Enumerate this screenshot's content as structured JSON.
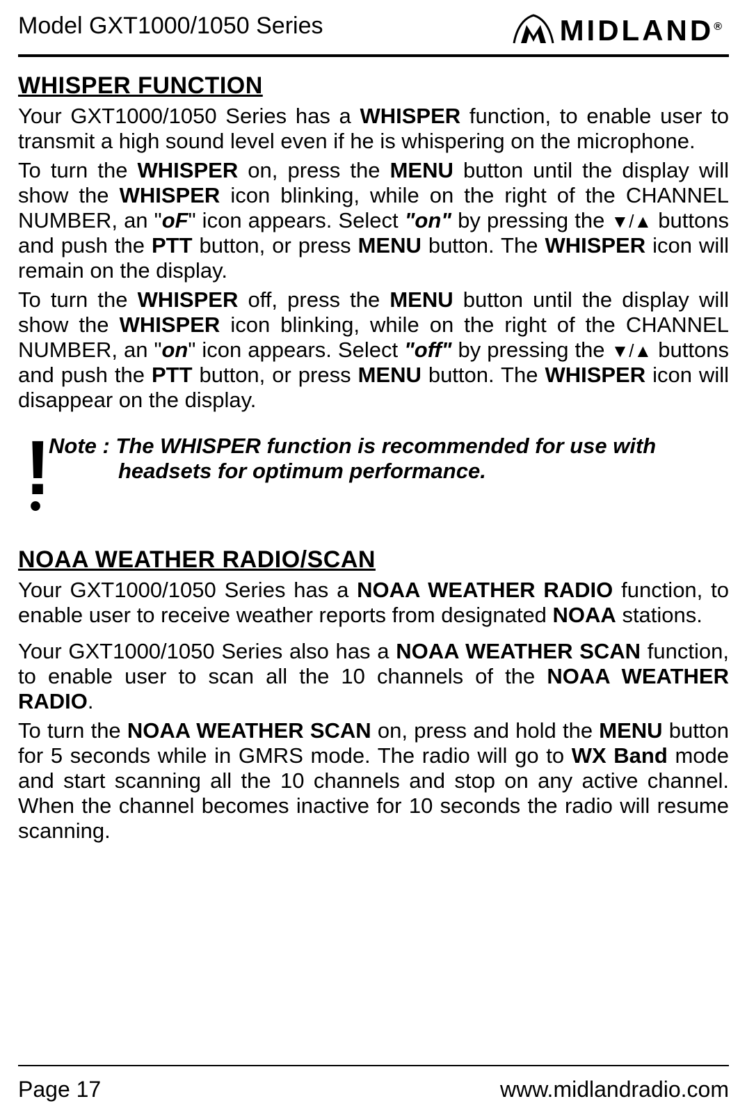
{
  "header": {
    "model_line": "Model GXT1000/1050 Series",
    "brand_text": "MIDLAND",
    "brand_reg": "®"
  },
  "sections": {
    "whisper": {
      "title": "WHISPER FUNCTION",
      "p1_a": "Your GXT1000/1050 Series has a ",
      "p1_b": "WHISPER",
      "p1_c": " function, to enable user to transmit a high sound level even if he is whispering on the microphone.",
      "p2_a": "To turn the ",
      "p2_b": "WHISPER",
      "p2_c": " on, press the ",
      "p2_d": "MENU",
      "p2_e": " button until the  display will show the ",
      "p2_f": "WHISPER",
      "p2_g": " icon blinking, while on the right of the CHANNEL NUMBER, an \"",
      "p2_h": "oF",
      "p2_i": "\" icon appears. Select ",
      "p2_j": "\"on\"",
      "p2_k": " by pressing the ",
      "p2_l": " buttons and push the ",
      "p2_m": "PTT",
      "p2_n": " button, or press ",
      "p2_o": "MENU",
      "p2_p": " button. The ",
      "p2_q": "WHISPER",
      "p2_r": " icon will remain on the display.",
      "p3_a": "To turn the ",
      "p3_b": "WHISPER",
      "p3_c": " off, press the ",
      "p3_d": "MENU",
      "p3_e": " button until the  display will show the ",
      "p3_f": "WHISPER",
      "p3_g": " icon blinking, while on the right of the CHANNEL NUMBER, an \"",
      "p3_h": "on",
      "p3_i": "\" icon appears. Select ",
      "p3_j": "\"off\"",
      "p3_k": " by pressing the ",
      "p3_l": " buttons and push the ",
      "p3_m": "PTT",
      "p3_n": " button, or press ",
      "p3_o": "MENU",
      "p3_p": " button. The ",
      "p3_q": "WHISPER",
      "p3_r": " icon will disappear on the display."
    },
    "note": {
      "line1": "Note : The WHISPER function is recommended for use with",
      "line2": "headsets for optimum performance."
    },
    "noaa": {
      "title": "NOAA WEATHER RADIO/SCAN",
      "p1_a": "Your GXT1000/1050 Series has a ",
      "p1_b": "NOAA WEATHER RADIO",
      "p1_c": " function, to enable user to receive weather reports from designated ",
      "p1_d": "NOAA",
      "p1_e": " stations.",
      "p2_a": "Your GXT1000/1050 Series also has a ",
      "p2_b": "NOAA WEATHER SCAN",
      "p2_c": " function, to enable user to scan all the 10 channels of the ",
      "p2_d": "NOAA WEATHER RADIO",
      "p2_e": ".",
      "p3_a": "To turn the ",
      "p3_b": "NOAA WEATHER SCAN",
      "p3_c": " on, press and hold the ",
      "p3_d": "MENU",
      "p3_e": " button for 5 seconds while in GMRS mode. The radio will go to ",
      "p3_f": "WX Band",
      "p3_g": " mode and start scanning all the 10 channels and stop on any active channel. When the channel becomes inactive for 10 seconds the radio will resume scanning."
    }
  },
  "footer": {
    "page": "Page 17",
    "url": "www.midlandradio.com"
  },
  "icons": {
    "down_up": "▼/▲"
  }
}
